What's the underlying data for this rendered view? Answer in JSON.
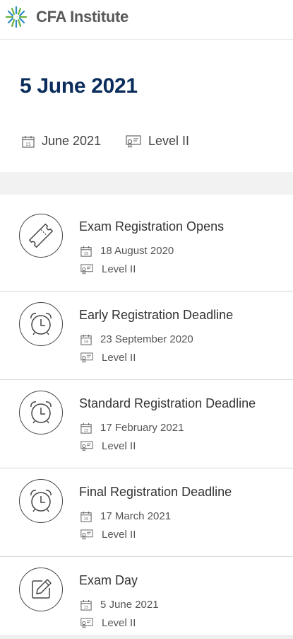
{
  "header": {
    "brand": "CFA Institute"
  },
  "hero": {
    "title": "5 June 2021",
    "date": "June 2021",
    "level": "Level II"
  },
  "events": [
    {
      "title": "Exam Registration Opens",
      "date": "18 August 2020",
      "level": "Level II",
      "icon": "ticket-icon"
    },
    {
      "title": "Early Registration Deadline",
      "date": "23 September 2020",
      "level": "Level II",
      "icon": "alarm-clock-icon"
    },
    {
      "title": "Standard Registration Deadline",
      "date": "17 February 2021",
      "level": "Level II",
      "icon": "alarm-clock-icon"
    },
    {
      "title": "Final Registration Deadline",
      "date": "17 March 2021",
      "level": "Level II",
      "icon": "alarm-clock-icon"
    },
    {
      "title": "Exam Day",
      "date": "5 June 2021",
      "level": "Level II",
      "icon": "edit-icon"
    }
  ],
  "colors": {
    "brand_title": "#0b2d5c",
    "text": "#333333",
    "muted": "#555555"
  }
}
